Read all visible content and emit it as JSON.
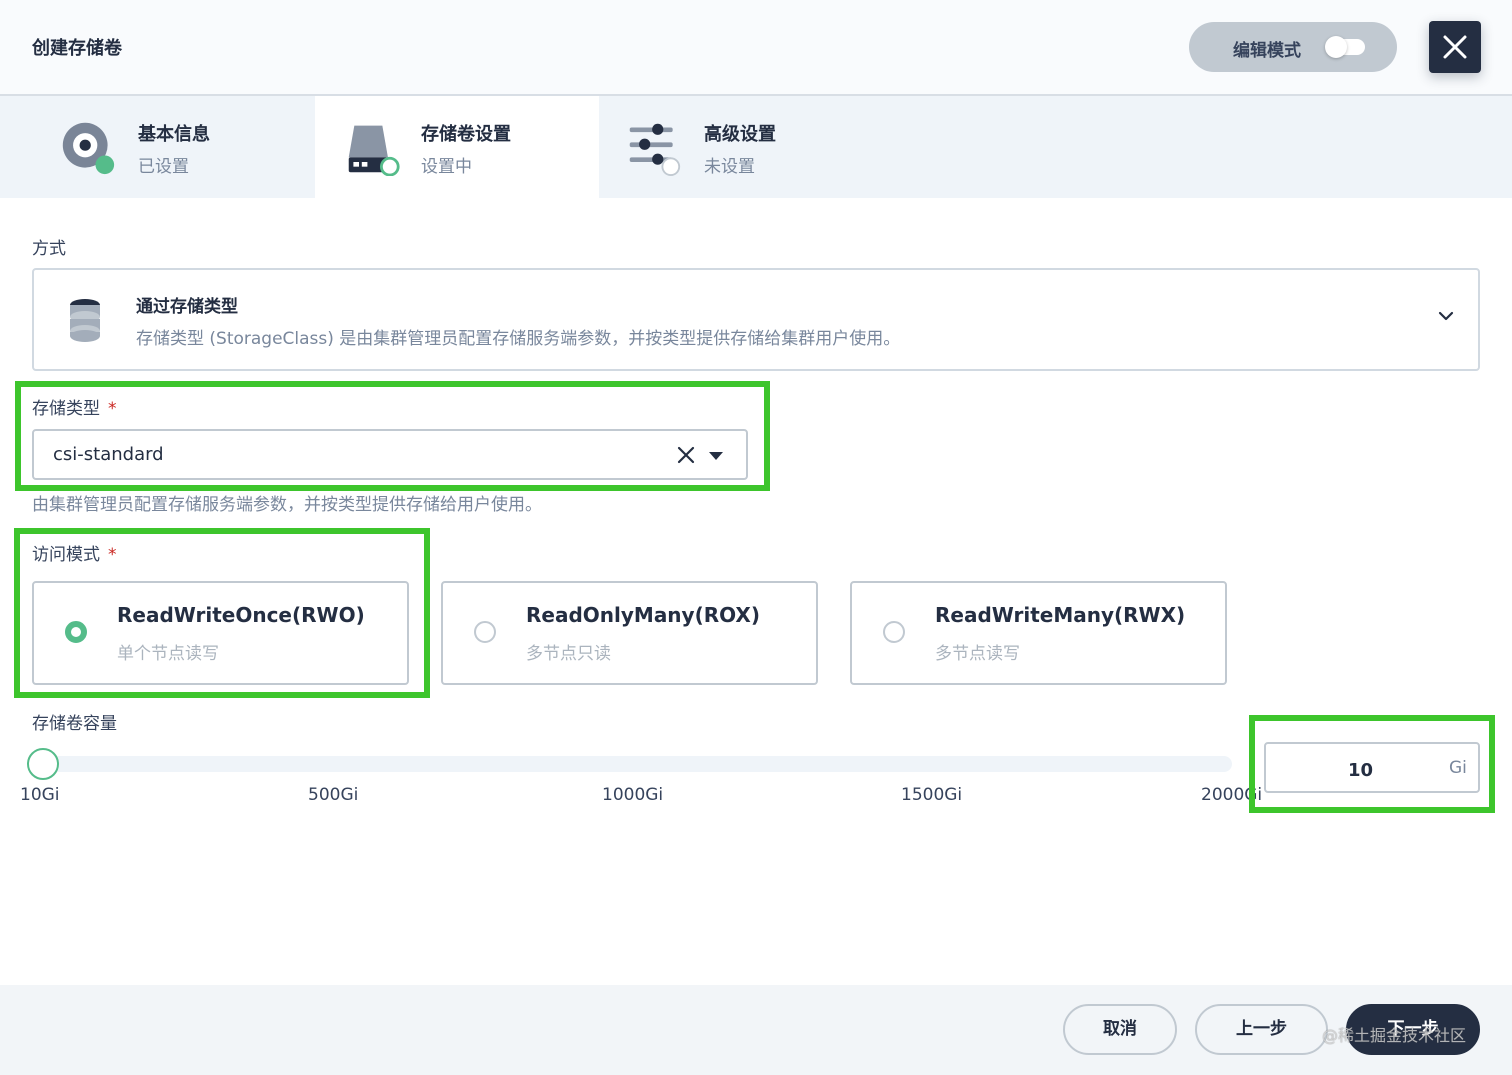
{
  "header": {
    "title": "创建存储卷",
    "edit_mode_label": "编辑模式"
  },
  "steps": [
    {
      "title": "基本信息",
      "status": "已设置"
    },
    {
      "title": "存储卷设置",
      "status": "设置中"
    },
    {
      "title": "高级设置",
      "status": "未设置"
    }
  ],
  "method": {
    "label": "方式",
    "title": "通过存储类型",
    "description": "存储类型 (StorageClass) 是由集群管理员配置存储服务端参数，并按类型提供存储给集群用户使用。"
  },
  "storage_class": {
    "label": "存储类型",
    "required_mark": "*",
    "value": "csi-standard",
    "hint": "由集群管理员配置存储服务端参数，并按类型提供存储给用户使用。"
  },
  "access_mode": {
    "label": "访问模式",
    "required_mark": "*",
    "options": [
      {
        "title": "ReadWriteOnce(RWO)",
        "subtitle": "单个节点读写",
        "selected": true
      },
      {
        "title": "ReadOnlyMany(ROX)",
        "subtitle": "多节点只读",
        "selected": false
      },
      {
        "title": "ReadWriteMany(RWX)",
        "subtitle": "多节点读写",
        "selected": false
      }
    ]
  },
  "capacity": {
    "label": "存储卷容量",
    "marks": [
      "10Gi",
      "500Gi",
      "1000Gi",
      "1500Gi",
      "2000Gi"
    ],
    "value": "10",
    "unit": "Gi"
  },
  "footer": {
    "cancel_label": "取消",
    "prev_label": "上一步",
    "next_label": "下一步",
    "watermark": "@稀土掘金技术社区"
  },
  "colors": {
    "primary_dark": "#242e42",
    "success_green": "#55bc8a",
    "highlight_green": "#3dc52c",
    "required_red": "#ca2621"
  }
}
